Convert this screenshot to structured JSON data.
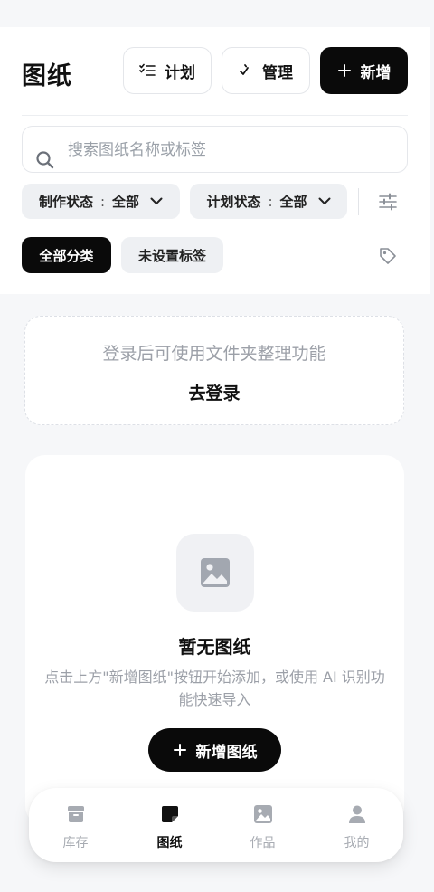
{
  "header": {
    "title": "图纸",
    "plan_label": "计划",
    "manage_label": "管理",
    "add_label": "新增"
  },
  "search": {
    "placeholder": "搜索图纸名称或标签",
    "value": ""
  },
  "filters": {
    "make_status": {
      "label": "制作状态",
      "separator": ":",
      "value": "全部"
    },
    "plan_status": {
      "label": "计划状态",
      "separator": ":",
      "value": "全部"
    }
  },
  "tags": {
    "all": "全部分类",
    "unset": "未设置标签"
  },
  "login_card": {
    "tip": "登录后可使用文件夹整理功能",
    "link": "去登录"
  },
  "empty_state": {
    "title": "暂无图纸",
    "description": "点击上方\"新增图纸\"按钮开始添加，或使用 AI 识别功能快速导入",
    "button": "新增图纸"
  },
  "tabbar": {
    "items": [
      {
        "label": "库存",
        "icon": "archive-icon",
        "active": false
      },
      {
        "label": "图纸",
        "icon": "sticky-note-icon",
        "active": true
      },
      {
        "label": "作品",
        "icon": "image-icon",
        "active": false
      },
      {
        "label": "我的",
        "icon": "user-icon",
        "active": false
      }
    ]
  },
  "colors": {
    "primary": "#0a0a0a",
    "muted_text": "#9ca0a8",
    "chip_bg": "#eef0f3",
    "page_bg": "#f6f7f9"
  }
}
